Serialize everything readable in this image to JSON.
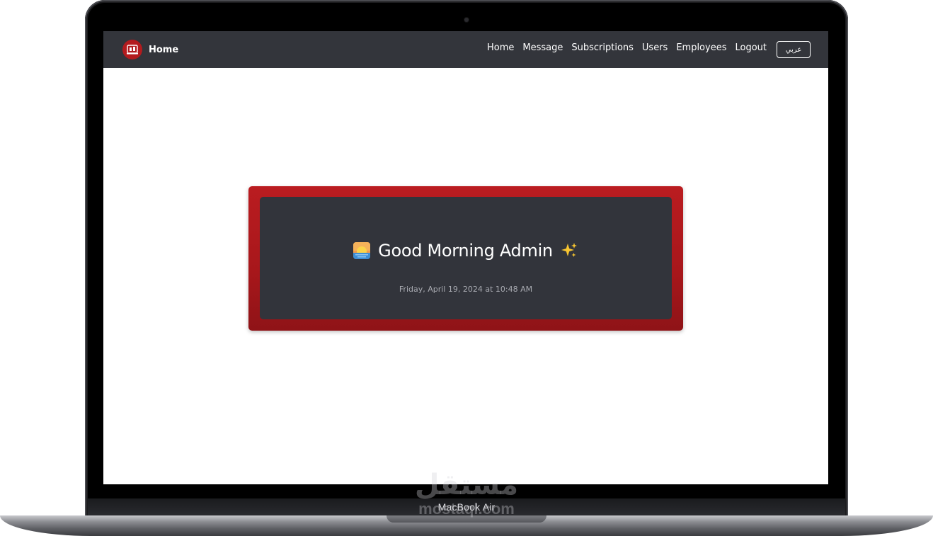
{
  "device": {
    "model_label": "MacBook Air",
    "watermark_arabic": "مستقل",
    "watermark_latin": "mostaql.com"
  },
  "navbar": {
    "brand_title": "Home",
    "brand_logo_icon": "logo-icon",
    "links": [
      {
        "label": "Home"
      },
      {
        "label": "Message"
      },
      {
        "label": "Subscriptions"
      },
      {
        "label": "Users"
      },
      {
        "label": "Employees"
      },
      {
        "label": "Logout"
      }
    ],
    "language_button": "عربي"
  },
  "greeting": {
    "leading_icon": "sunrise-icon",
    "text": "Good Morning Admin",
    "trailing_icon": "sparkles-icon",
    "datetime": "Friday, April 19, 2024 at 10:48 AM"
  },
  "colors": {
    "navbar_bg": "#33353b",
    "brand_red": "#b31b1e",
    "card_inner_bg": "#32343b",
    "sparkle_yellow": "#f7c531"
  }
}
